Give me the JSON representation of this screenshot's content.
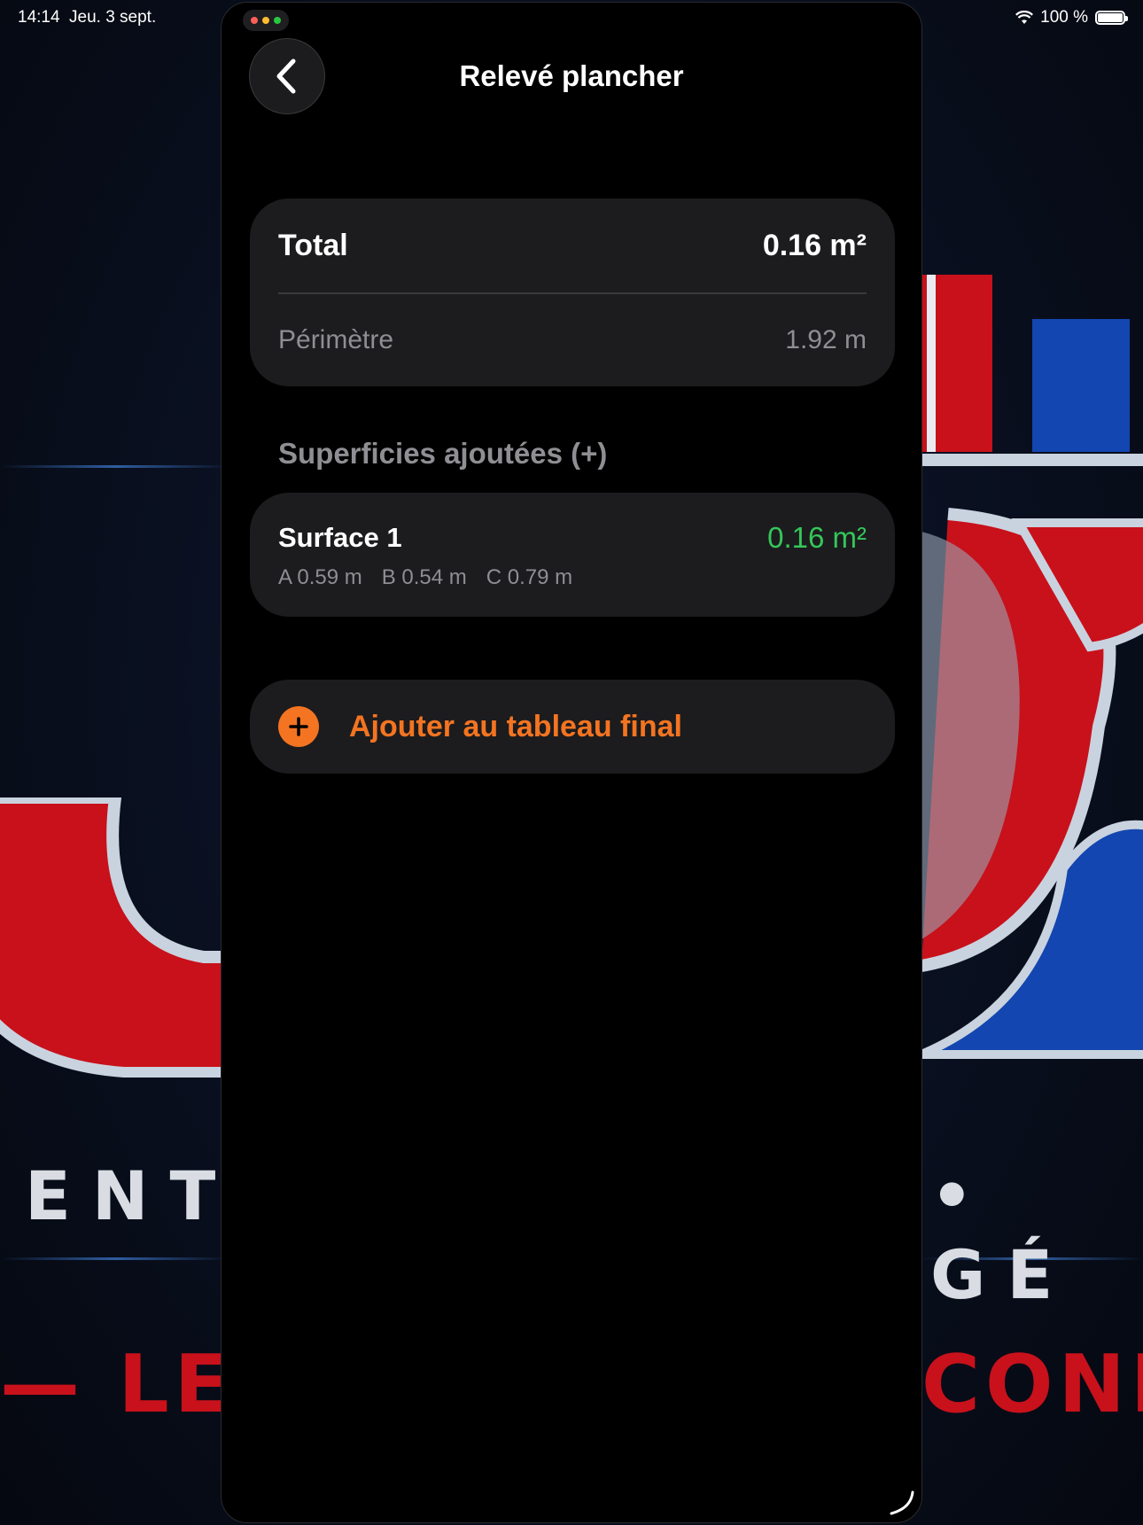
{
  "status_bar": {
    "time": "14:14",
    "date": "Jeu. 3 sept.",
    "battery": "100 %"
  },
  "app": {
    "title": "Relevé plancher",
    "back_icon": "chevron-left-icon"
  },
  "summary": {
    "total_label": "Total",
    "total_value": "0.16 m²",
    "perimeter_label": "Périmètre",
    "perimeter_value": "1.92 m"
  },
  "section": {
    "title": "Superficies ajoutées (+)"
  },
  "surfaces": [
    {
      "name": "Surface 1",
      "value": "0.16 m²",
      "dims": [
        "A 0.59 m",
        "B 0.54 m",
        "C 0.79 m"
      ]
    }
  ],
  "actions": {
    "add_label": "Ajouter au tableau final",
    "add_icon": "plus-circle-icon"
  },
  "colors": {
    "accent": "#f47421",
    "positive": "#34c759",
    "card": "#1c1c1e",
    "background": "#000000"
  },
  "wallpaper": {
    "letters_left": "ENT",
    "letters_right": "• GÉ",
    "red_left": "— LE",
    "red_right": "CONF"
  }
}
